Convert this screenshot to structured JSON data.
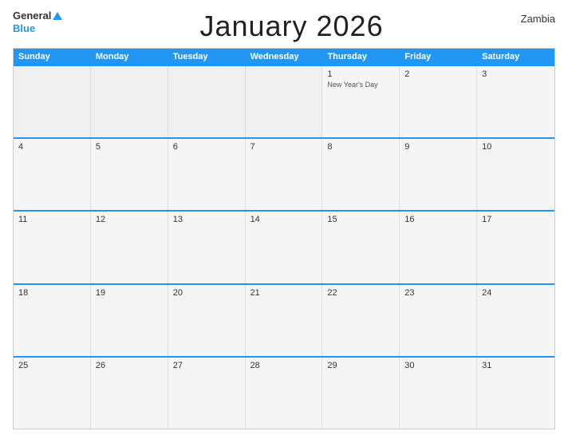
{
  "header": {
    "logo": {
      "general": "General",
      "blue": "Blue"
    },
    "title": "January 2026",
    "country": "Zambia"
  },
  "days_of_week": [
    "Sunday",
    "Monday",
    "Tuesday",
    "Wednesday",
    "Thursday",
    "Friday",
    "Saturday"
  ],
  "weeks": [
    [
      {
        "day": "",
        "holiday": ""
      },
      {
        "day": "",
        "holiday": ""
      },
      {
        "day": "",
        "holiday": ""
      },
      {
        "day": "",
        "holiday": ""
      },
      {
        "day": "1",
        "holiday": "New Year's Day"
      },
      {
        "day": "2",
        "holiday": ""
      },
      {
        "day": "3",
        "holiday": ""
      }
    ],
    [
      {
        "day": "4",
        "holiday": ""
      },
      {
        "day": "5",
        "holiday": ""
      },
      {
        "day": "6",
        "holiday": ""
      },
      {
        "day": "7",
        "holiday": ""
      },
      {
        "day": "8",
        "holiday": ""
      },
      {
        "day": "9",
        "holiday": ""
      },
      {
        "day": "10",
        "holiday": ""
      }
    ],
    [
      {
        "day": "11",
        "holiday": ""
      },
      {
        "day": "12",
        "holiday": ""
      },
      {
        "day": "13",
        "holiday": ""
      },
      {
        "day": "14",
        "holiday": ""
      },
      {
        "day": "15",
        "holiday": ""
      },
      {
        "day": "16",
        "holiday": ""
      },
      {
        "day": "17",
        "holiday": ""
      }
    ],
    [
      {
        "day": "18",
        "holiday": ""
      },
      {
        "day": "19",
        "holiday": ""
      },
      {
        "day": "20",
        "holiday": ""
      },
      {
        "day": "21",
        "holiday": ""
      },
      {
        "day": "22",
        "holiday": ""
      },
      {
        "day": "23",
        "holiday": ""
      },
      {
        "day": "24",
        "holiday": ""
      }
    ],
    [
      {
        "day": "25",
        "holiday": ""
      },
      {
        "day": "26",
        "holiday": ""
      },
      {
        "day": "27",
        "holiday": ""
      },
      {
        "day": "28",
        "holiday": ""
      },
      {
        "day": "29",
        "holiday": ""
      },
      {
        "day": "30",
        "holiday": ""
      },
      {
        "day": "31",
        "holiday": ""
      }
    ]
  ],
  "colors": {
    "header_bg": "#2196F3",
    "accent": "#2196F3"
  }
}
